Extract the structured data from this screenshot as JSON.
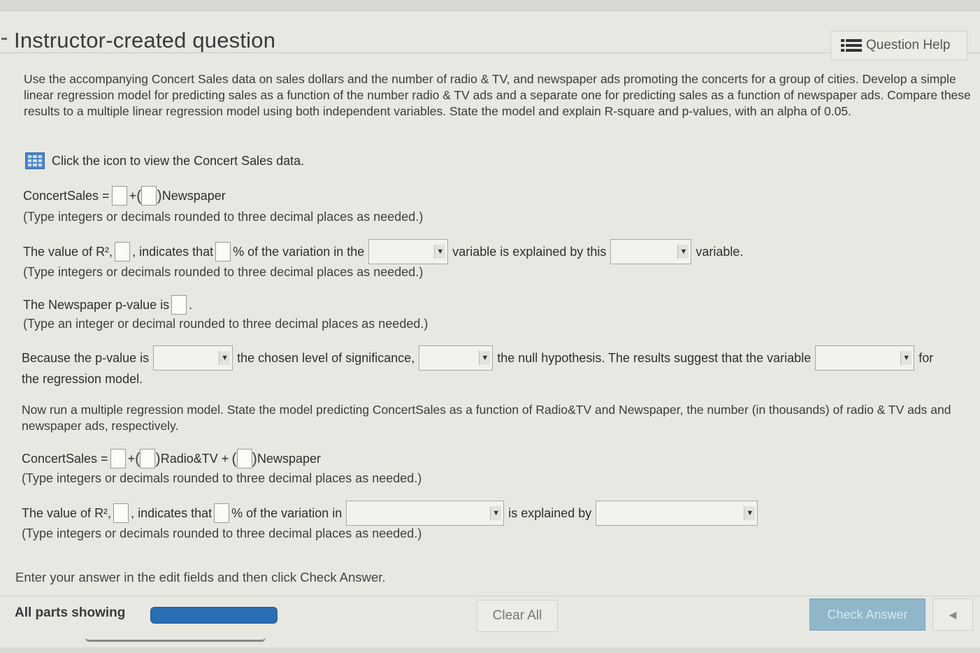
{
  "header": {
    "title": "Instructor-created question",
    "help_label": "Question Help"
  },
  "intro": {
    "text": "Use the accompanying Concert Sales data on sales dollars and the number of radio & TV, and newspaper ads promoting the concerts for a group of cities. Develop a simple linear regression model for predicting sales as a function of the number radio & TV ads and a separate one for predicting sales as a function of newspaper ads. Compare these results to a multiple linear regression model using both independent variables. State the model and explain R-square and p-values, with an alpha of 0.05."
  },
  "data_link": {
    "text": "Click the icon to view the Concert Sales data."
  },
  "q1": {
    "lhs": "ConcertSales =",
    "plus": "+",
    "var": "Newspaper",
    "note": "(Type integers or decimals rounded to three decimal places as needed.)"
  },
  "q2": {
    "t1": "The value of R²,",
    "t2": ", indicates that",
    "t3": "% of the variation in the",
    "t4": "variable is explained by this",
    "t5": "variable.",
    "note": "(Type integers or decimals rounded to three decimal places as needed.)"
  },
  "q3": {
    "t1": "The Newspaper p-value is",
    "t2": ".",
    "note": "(Type an integer or decimal rounded to three decimal places as needed.)"
  },
  "q4": {
    "t1": "Because the p-value is",
    "t2": "the chosen level of significance,",
    "t3": "the null hypothesis. The results suggest that the variable",
    "t4": "for",
    "t5": "the regression model."
  },
  "q5": {
    "text": "Now run a multiple regression model. State the model predicting ConcertSales as a function of Radio&TV and Newspaper, the number (in thousands) of radio & TV ads and newspaper ads, respectively."
  },
  "q6": {
    "lhs": "ConcertSales =",
    "plus": "+",
    "var1": "Radio&TV +",
    "var2": "Newspaper",
    "note": "(Type integers or decimals rounded to three decimal places as needed.)"
  },
  "q7": {
    "t1": "The value of R²,",
    "t2": ", indicates that",
    "t3": "% of the variation in",
    "t4": "is explained by",
    "note": "(Type integers or decimals rounded to three decimal places as needed.)"
  },
  "footer": {
    "instruction": "Enter your answer in the edit fields and then click Check Answer.",
    "parts_label": "All parts showing",
    "clear_label": "Clear All",
    "check_label": "Check Answer"
  },
  "icons": {
    "help": "list-icon",
    "data": "table-grid-icon",
    "back": "triangle-left-icon",
    "dropdown": "triangle-down-icon"
  },
  "colors": {
    "progress": "#2a6fb3",
    "check_button": "#8fb6c9",
    "data_icon": "#4a86c8"
  }
}
